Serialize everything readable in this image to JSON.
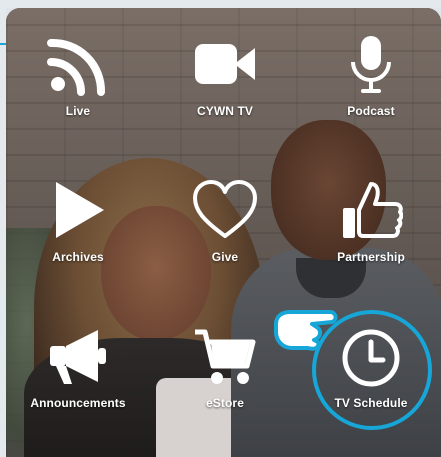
{
  "menu": {
    "items": [
      {
        "label": "Live",
        "icon": "rss-icon"
      },
      {
        "label": "CYWN TV",
        "icon": "video-camera-icon"
      },
      {
        "label": "Podcast",
        "icon": "microphone-icon"
      },
      {
        "label": "Archives",
        "icon": "play-icon"
      },
      {
        "label": "Give",
        "icon": "heart-icon"
      },
      {
        "label": "Partnership",
        "icon": "thumbs-up-icon"
      },
      {
        "label": "Announcements",
        "icon": "megaphone-icon"
      },
      {
        "label": "eStore",
        "icon": "shopping-cart-icon"
      },
      {
        "label": "TV Schedule",
        "icon": "clock-icon"
      }
    ]
  },
  "highlight": {
    "target": "TV Schedule",
    "color": "#17a6d8"
  }
}
